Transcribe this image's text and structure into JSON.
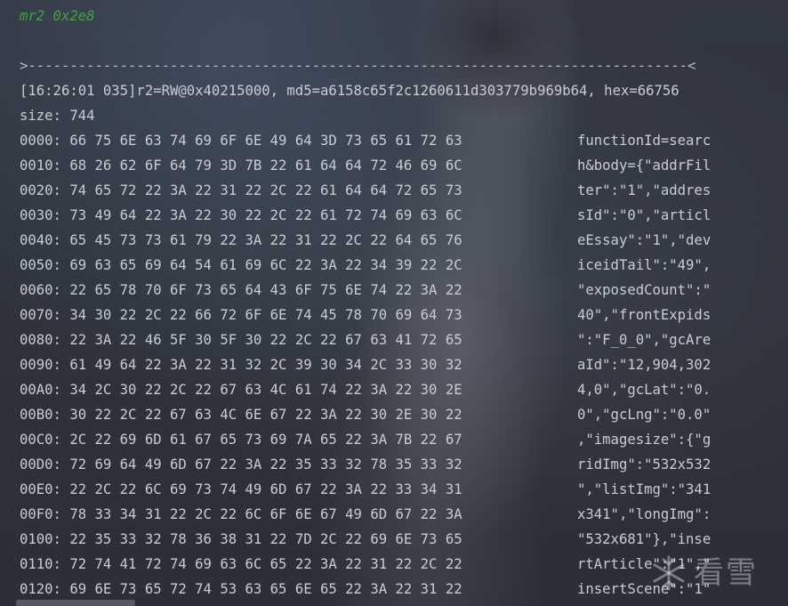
{
  "console": {
    "command": "mr2 0x2e8",
    "separator": ">-------------------------------------------------------------------------------<",
    "info": "[16:26:01 035]r2=RW@0x40215000, md5=a6158c65f2c1260611d303779b969b64, hex=66756",
    "size": "size: 744",
    "rows": [
      {
        "offset": "0000:",
        "hex": "66 75 6E 63 74 69 6F 6E 49 64 3D 73 65 61 72 63",
        "ascii": "functionId=searc"
      },
      {
        "offset": "0010:",
        "hex": "68 26 62 6F 64 79 3D 7B 22 61 64 64 72 46 69 6C",
        "ascii": "h&body={\"addrFil"
      },
      {
        "offset": "0020:",
        "hex": "74 65 72 22 3A 22 31 22 2C 22 61 64 64 72 65 73",
        "ascii": "ter\":\"1\",\"addres"
      },
      {
        "offset": "0030:",
        "hex": "73 49 64 22 3A 22 30 22 2C 22 61 72 74 69 63 6C",
        "ascii": "sId\":\"0\",\"articl"
      },
      {
        "offset": "0040:",
        "hex": "65 45 73 73 61 79 22 3A 22 31 22 2C 22 64 65 76",
        "ascii": "eEssay\":\"1\",\"dev"
      },
      {
        "offset": "0050:",
        "hex": "69 63 65 69 64 54 61 69 6C 22 3A 22 34 39 22 2C",
        "ascii": "iceidTail\":\"49\","
      },
      {
        "offset": "0060:",
        "hex": "22 65 78 70 6F 73 65 64 43 6F 75 6E 74 22 3A 22",
        "ascii": "\"exposedCount\":\""
      },
      {
        "offset": "0070:",
        "hex": "34 30 22 2C 22 66 72 6F 6E 74 45 78 70 69 64 73",
        "ascii": "40\",\"frontExpids"
      },
      {
        "offset": "0080:",
        "hex": "22 3A 22 46 5F 30 5F 30 22 2C 22 67 63 41 72 65",
        "ascii": "\":\"F_0_0\",\"gcAre"
      },
      {
        "offset": "0090:",
        "hex": "61 49 64 22 3A 22 31 32 2C 39 30 34 2C 33 30 32",
        "ascii": "aId\":\"12,904,302"
      },
      {
        "offset": "00A0:",
        "hex": "34 2C 30 22 2C 22 67 63 4C 61 74 22 3A 22 30 2E",
        "ascii": "4,0\",\"gcLat\":\"0."
      },
      {
        "offset": "00B0:",
        "hex": "30 22 2C 22 67 63 4C 6E 67 22 3A 22 30 2E 30 22",
        "ascii": "0\",\"gcLng\":\"0.0\""
      },
      {
        "offset": "00C0:",
        "hex": "2C 22 69 6D 61 67 65 73 69 7A 65 22 3A 7B 22 67",
        "ascii": ",\"imagesize\":{\"g"
      },
      {
        "offset": "00D0:",
        "hex": "72 69 64 49 6D 67 22 3A 22 35 33 32 78 35 33 32",
        "ascii": "ridImg\":\"532x532"
      },
      {
        "offset": "00E0:",
        "hex": "22 2C 22 6C 69 73 74 49 6D 67 22 3A 22 33 34 31",
        "ascii": "\",\"listImg\":\"341"
      },
      {
        "offset": "00F0:",
        "hex": "78 33 34 31 22 2C 22 6C 6F 6E 67 49 6D 67 22 3A",
        "ascii": "x341\",\"longImg\":"
      },
      {
        "offset": "0100:",
        "hex": "22 35 33 32 78 36 38 31 22 7D 2C 22 69 6E 73 65",
        "ascii": "\"532x681\"},\"inse"
      },
      {
        "offset": "0110:",
        "hex": "72 74 41 72 74 69 63 6C 65 22 3A 22 31 22 2C 22",
        "ascii": "rtArticle\":\"1\",\""
      },
      {
        "offset": "0120:",
        "hex": "69 6E 73 65 72 74 53 63 65 6E 65 22 3A 22 31 22",
        "ascii": "insertScene\":\"1\""
      }
    ]
  },
  "watermark": {
    "text": "看雪",
    "icon": "snowflake-icon"
  },
  "colors": {
    "command": "#3fa23f",
    "text": "#c9cdd3",
    "background": "#2b2d30"
  }
}
